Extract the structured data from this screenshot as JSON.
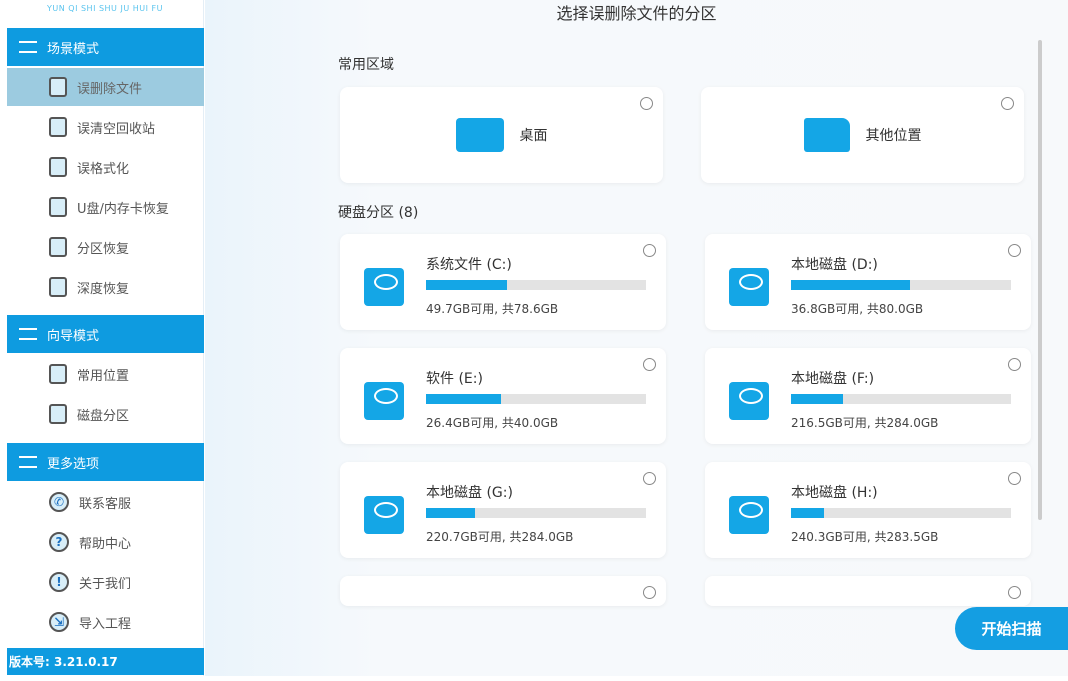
{
  "sidebar": {
    "logo_subtitle": "YUN QI SHI SHU JU HUI FU",
    "sections": [
      {
        "label": "场景模式",
        "items": [
          "误删除文件",
          "误清空回收站",
          "误格式化",
          "U盘/内存卡恢复",
          "分区恢复",
          "深度恢复"
        ]
      },
      {
        "label": "向导模式",
        "items": [
          "常用位置",
          "磁盘分区"
        ]
      },
      {
        "label": "更多选项",
        "items": [
          "联系客服",
          "帮助中心",
          "关于我们",
          "导入工程"
        ]
      }
    ],
    "selected": "误删除文件",
    "version": "版本号: 3.21.0.17"
  },
  "main": {
    "title": "选择误删除文件的分区",
    "common_label": "常用区域",
    "common": [
      "桌面",
      "其他位置"
    ],
    "disk_label": "硬盘分区 (8)",
    "disks": [
      {
        "name": "系统文件 (C:)",
        "free": 49.7,
        "total": 78.6,
        "size_text": "49.7GB可用, 共78.6GB"
      },
      {
        "name": "本地磁盘 (D:)",
        "free": 36.8,
        "total": 80.0,
        "size_text": "36.8GB可用, 共80.0GB"
      },
      {
        "name": "软件 (E:)",
        "free": 26.4,
        "total": 40.0,
        "size_text": "26.4GB可用, 共40.0GB"
      },
      {
        "name": "本地磁盘 (F:)",
        "free": 216.5,
        "total": 284.0,
        "size_text": "216.5GB可用, 共284.0GB"
      },
      {
        "name": "本地磁盘 (G:)",
        "free": 220.7,
        "total": 284.0,
        "size_text": "220.7GB可用, 共284.0GB"
      },
      {
        "name": "本地磁盘 (H:)",
        "free": 240.3,
        "total": 283.5,
        "size_text": "240.3GB可用, 共283.5GB"
      }
    ],
    "start_label": "开始扫描"
  }
}
